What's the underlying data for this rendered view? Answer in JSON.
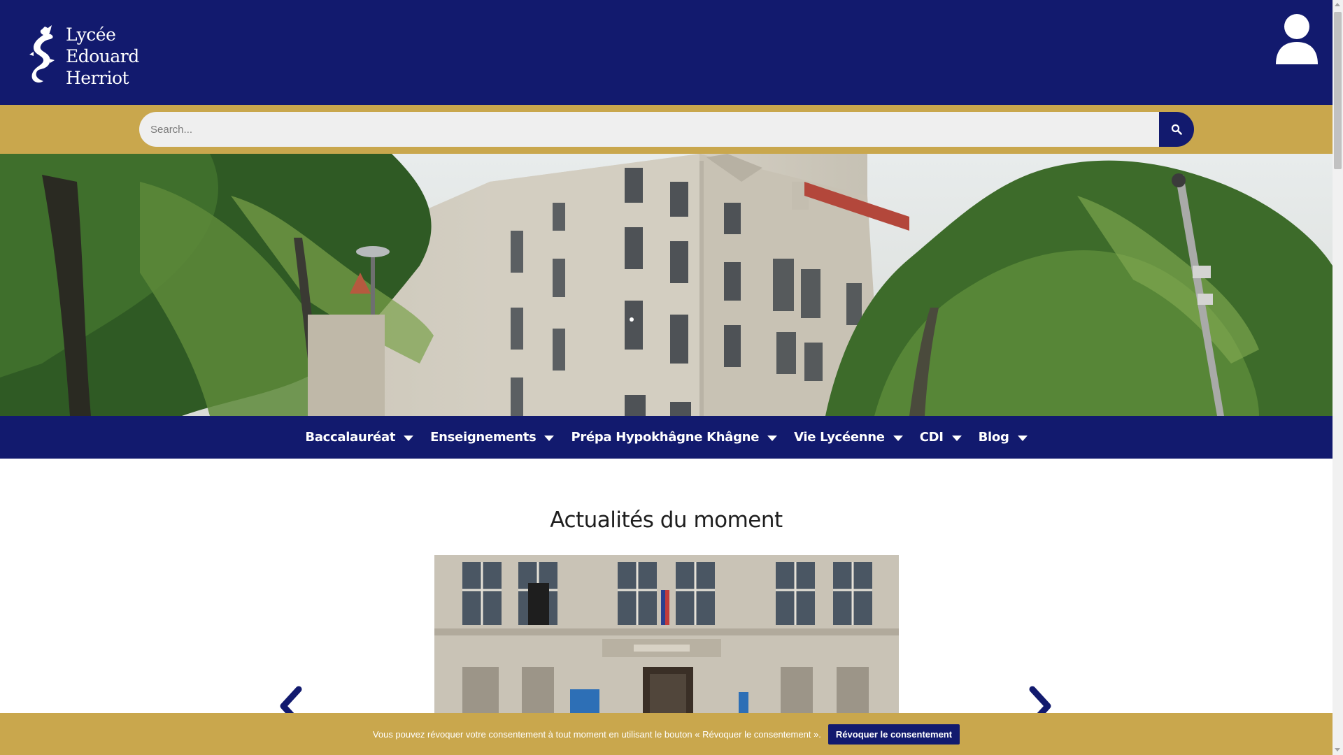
{
  "header": {
    "logo_lines": [
      "Lycée",
      "Edouard",
      "Herriot"
    ],
    "user_icon": "user-icon"
  },
  "search": {
    "placeholder": "Search...",
    "button_icon": "search-icon"
  },
  "hero": {
    "image": "school-building-photo"
  },
  "nav": {
    "items": [
      {
        "label": "Baccalauréat"
      },
      {
        "label": "Enseignements"
      },
      {
        "label": "Prépa Hypokhâgne Khâgne"
      },
      {
        "label": "Vie Lycéenne"
      },
      {
        "label": "CDI"
      },
      {
        "label": "Blog"
      }
    ]
  },
  "news": {
    "title": "Actualités du moment",
    "prev_icon": "chevron-left-icon",
    "next_icon": "chevron-right-icon"
  },
  "cookie": {
    "text": "Vous pouvez révoquer votre consentement à tout moment en utilisant le bouton « Révoquer le consentement ».",
    "button": "Révoquer le consentement"
  },
  "colors": {
    "navy": "#121a6e",
    "gold": "#c9a74d"
  }
}
